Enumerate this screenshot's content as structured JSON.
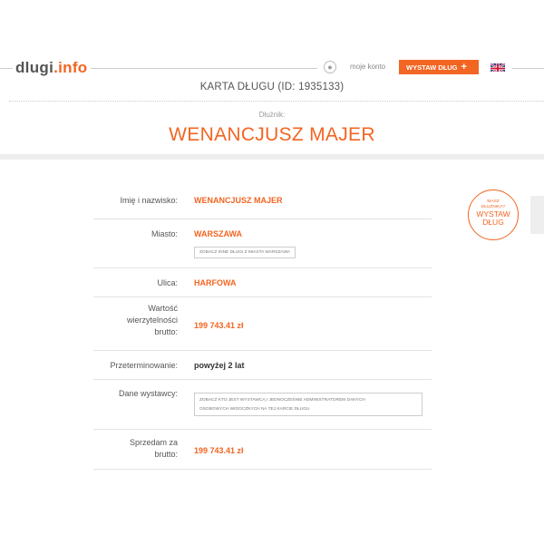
{
  "header": {
    "logo_main": "dlugi",
    "logo_ext": ".info",
    "account_label": "moje konto",
    "add_debt_label": "WYSTAW DŁUG",
    "add_debt_icon": "plus-icon",
    "language_flag": "uk-flag-icon"
  },
  "card": {
    "title": "KARTA DŁUGU (ID: 1935133)",
    "debtor_label": "Dłużnik:",
    "debtor_name": "WENANCJUSZ MAJER"
  },
  "details": {
    "name_label": "Imię i nazwisko:",
    "name_value": "WENANCJUSZ MAJER",
    "city_label": "Miasto:",
    "city_value": "WARSZAWA",
    "city_button": "ZOBACZ INNE DŁUGI Z MIASTA WARSZAWA",
    "street_label": "Ulica:",
    "street_value": "HARFOWA",
    "amount_label_1": "Wartość",
    "amount_label_2": "wierzytelności",
    "amount_label_3": "brutto:",
    "amount_value": "199 743.41 zł",
    "overdue_label": "Przeterminowanie:",
    "overdue_value": "powyżej 2 lat",
    "issuer_label": "Dane wystawcy:",
    "issuer_button_1": "ZOBACZ KTO JEST WYSTAWCĄ I JEDNOCZEŚNIE ADMINISTRATOREM DANYCH",
    "issuer_button_2": "OSOBOWYCH WIDOCZNYCH NA TEJ KARCIE DŁUGU",
    "sell_label_1": "Sprzedam za",
    "sell_label_2": "brutto:",
    "sell_value": "199 743.41 zł"
  },
  "badge": {
    "small_1": "MASZ",
    "small_2": "DŁUŻNIKA?",
    "big_1": "WYSTAW",
    "big_2": "DŁUG"
  },
  "colors": {
    "accent": "#f26522",
    "text": "#555555",
    "band": "#eeeeee"
  }
}
